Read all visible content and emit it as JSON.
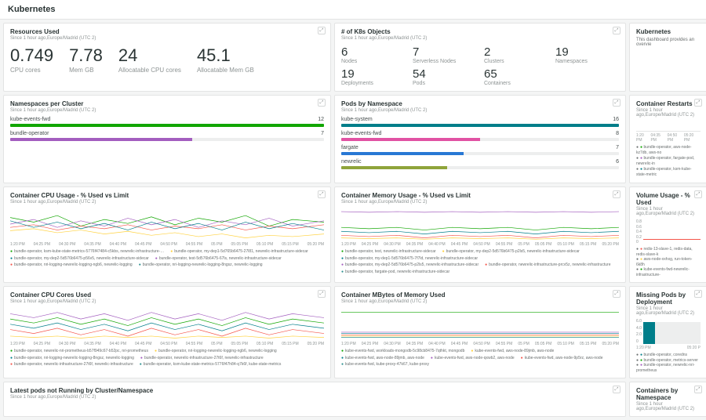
{
  "header": {
    "title": "Kubernetes"
  },
  "sidebar": {
    "title": "Kubernetes",
    "desc": "This dashboard provides an overvie"
  },
  "resources": {
    "title": "Resources Used",
    "sub": "Since 1 hour ago,Europe/Madrid (UTC 2)",
    "items": [
      {
        "val": "0.749",
        "lbl": "CPU cores"
      },
      {
        "val": "7.78",
        "lbl": "Mem GB"
      },
      {
        "val": "24",
        "lbl": "Allocatable CPU cores"
      },
      {
        "val": "45.1",
        "lbl": "Allocatable Mem GB"
      }
    ]
  },
  "k8sobj": {
    "title": "# of K8s Objects",
    "sub": "Since 1 hour ago,Europe/Madrid (UTC 2)",
    "items": [
      {
        "val": "6",
        "lbl": "Nodes"
      },
      {
        "val": "7",
        "lbl": "Serverless Nodes"
      },
      {
        "val": "2",
        "lbl": "Clusters"
      },
      {
        "val": "19",
        "lbl": "Namespaces"
      },
      {
        "val": "19",
        "lbl": "Deployments"
      },
      {
        "val": "54",
        "lbl": "Pods"
      },
      {
        "val": "65",
        "lbl": "Containers"
      }
    ]
  },
  "nsPerCluster": {
    "title": "Namespaces per Cluster",
    "sub": "Since 1 hour ago,Europe/Madrid (UTC 2)",
    "rows": [
      {
        "name": "kube-events-fwd",
        "val": "12",
        "pct": 100,
        "color": "#11a600"
      },
      {
        "name": "bundle-operator",
        "val": "7",
        "pct": 58,
        "color": "#a35ebf"
      }
    ]
  },
  "podsByNs": {
    "title": "Pods by Namespace",
    "sub": "Since 1 hour ago,Europe/Madrid (UTC 2)",
    "rows": [
      {
        "name": "kube-system",
        "val": "16",
        "pct": 100,
        "color": "#007e8a"
      },
      {
        "name": "kube-events-fwd",
        "val": "8",
        "pct": 50,
        "color": "#e152a3"
      },
      {
        "name": "fargate",
        "val": "7",
        "pct": 44,
        "color": "#2878d4"
      },
      {
        "name": "newrelic",
        "val": "6",
        "pct": 38,
        "color": "#8fa43a"
      }
    ]
  },
  "restarts": {
    "title": "Container Restarts",
    "sub": "Since 1 hour ago,Europe/Madrid (UTC 2)",
    "ticks": [
      "1:20 PM",
      "04:35 PM",
      "04:50 PM",
      "05:20 PM"
    ],
    "legend": [
      "bundle-operator, aws-node-kz7db, aws-no",
      "bundle-operator, fargate-pod, newrelic-in",
      "bundle-operator, ksm-kube-state-metric"
    ]
  },
  "cpuPct": {
    "title": "Container CPU Usage - % Used vs Limit",
    "sub": "Since 1 hour ago,Europe/Madrid (UTC 2)",
    "ticks": [
      "1:20 PM",
      "04:25 PM",
      "04:30 PM",
      "04:35 PM",
      "04:40 PM",
      "04:45 PM",
      "04:50 PM",
      "04:55 PM",
      "05 PM",
      "05:05 PM",
      "05:10 PM",
      "05:15 PM",
      "05:20 PM"
    ],
    "legend1": [
      "bundle-operator, ksm-kube-state-metrics-5776f47484-c5kbs, newrelic-infrastructure-…",
      "bundle-operator, my-dep1-5d765b6475-27l81, newrelic-infrastructure-sidecar"
    ],
    "legend2": [
      "bundle-operator, my-dep2-5d576b6475-p56v5, newrelic-infrastructure-sidecar",
      "bundle-operator, test-5d576b6475-67ls, newrelic-infrastructure-sidecar"
    ],
    "legend3": [
      "bundle-operator, nri-logging-newrelic-logging-ngb6, newrelic-logging",
      "bundle-operator, nri-logging-newrelic-logging-8ngsz, newrelic-logging"
    ]
  },
  "memPct": {
    "title": "Container Memory Usage - % Used vs Limit",
    "sub": "Since 1 hour ago,Europe/Madrid (UTC 2)",
    "ticks": [
      "1:20 PM",
      "04:25 PM",
      "04:30 PM",
      "04:35 PM",
      "04:40 PM",
      "04:45 PM",
      "04:50 PM",
      "04:55 PM",
      "05 PM",
      "05:05 PM",
      "05:10 PM",
      "05:15 PM",
      "05:20 PM"
    ],
    "legend1": [
      "bundle-operator, test, newrelic-infrastructure-sidecar",
      "bundle-operator, my-dep2-5d576b6475-p2ls5, newrelic-infrastructure-sidecar"
    ],
    "legend2": [
      "bundle-operator, my-dep1-5d576b6475-7f7ld, newrelic-infrastructure-sidecar",
      "bundle-operator, my-dep2-5d576b6475-p2ls5, newrelic-infrastructure-sidecar"
    ],
    "legend3": [
      "bundle-operator, newrelic-infrastructure-prcv5z, newrelic-infrastructure",
      "bundle-operator, fargate-pod, newrelic-infrastructure-sidecar"
    ]
  },
  "volume": {
    "title": "Volume Usage - % Used",
    "sub": "Since 1 hour ago,Europe/Madrid (UTC 2)",
    "yticks": [
      "0.8",
      "0.6",
      "0.4",
      "0.2",
      "0"
    ],
    "legend": [
      "redis-13-slave-1, redis-data, redis-slave-k",
      "aws-node-xxhxg, run-token-6k8h",
      "kube-events-fwd-newrelic-infrastructure-"
    ]
  },
  "cpuCores": {
    "title": "Container CPU Cores Used",
    "sub": "Since 1 hour ago,Europe/Madrid (UTC 2)",
    "ticks": [
      "1:20 PM",
      "04:25 PM",
      "04:30 PM",
      "04:35 PM",
      "04:40 PM",
      "04:45 PM",
      "04:50 PM",
      "04:55 PM",
      "05 PM",
      "05:05 PM",
      "05:10 PM",
      "05:15 PM",
      "05:20 PM"
    ],
    "legend1": [
      "bundle-operator, newrelic-nri-prometheus-b57f949c67-b52pc, nri-prometheus",
      "bundle-operator, nri-logging-newrelic-logging-ngb6, newrelic-logging"
    ],
    "legend2": [
      "bundle-operator, nri-logging-newrelic-logging-8ngsz, newrelic-logging",
      "bundle-operator, newrelic-infrastructure-27t6f, newrelic-infrastructure"
    ],
    "legend3": [
      "bundle-operator, newrelic-infrastructure-27t6f, newrelic-infrastructure",
      "bundle-operator, ksm-kube-state-metrics-5776f47h84-q7k6f, kube-state-metrics"
    ]
  },
  "memBytes": {
    "title": "Container MBytes of Memory Used",
    "sub": "Since 1 hour ago,Europe/Madrid (UTC 2)",
    "ticks": [
      "1:20 PM",
      "04:25 PM",
      "04:30 PM",
      "04:35 PM",
      "04:40 PM",
      "04:45 PM",
      "04:50 PM",
      "04:55 PM",
      "05 PM",
      "05:05 PM",
      "05:10 PM",
      "05:15 PM",
      "05:20 PM"
    ],
    "legend1": [
      "kube-events-fwd, workloads-mongodb-5c98cb8475-7qthkt, mongodb",
      "kube-events-fwd, aws-node-89jmb, aws-node"
    ],
    "legend2": [
      "kube-events-fwd, aws-node-89jmb, aws-node",
      "kube-events-fwd, aws-node-qxwb2, aws-node"
    ],
    "legend3": [
      "kube-events-fwd, aws-node-9p5rz, aws-node",
      "kube-events-fwd, kube-proxy-47k67, kube-proxy"
    ]
  },
  "missing": {
    "title": "Missing Pods by Deployment",
    "sub": "Since 1 hour ago,Europe/Madrid (UTC 2)",
    "yticks": [
      "6.0",
      "4.0",
      "2.0",
      "0"
    ],
    "legend": [
      "bundle-operator, coredns",
      "bundle-operator, metrics-server",
      "bundle-operator, newrelic-nri-prometheus"
    ]
  },
  "latestNotRunning": {
    "title": "Latest pods not Running by Cluster/Namespace",
    "sub": "Since 1 hour ago,Europe/Madrid (UTC 2)"
  },
  "containersByNs": {
    "title": "Containers by Namespace",
    "sub": "Since 1 hour ago,Europe/Madrid (UTC 2)"
  }
}
